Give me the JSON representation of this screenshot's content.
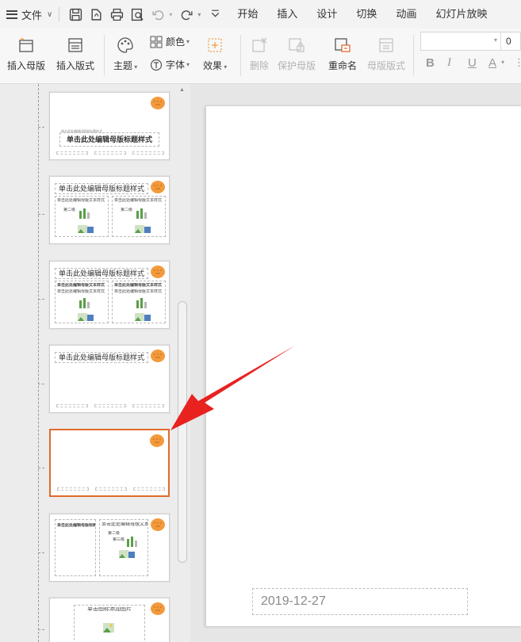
{
  "menubar": {
    "file_label": "文件",
    "tabs": [
      "开始",
      "插入",
      "设计",
      "切换",
      "动画",
      "幻灯片放映"
    ]
  },
  "ribbon": {
    "insert_master": "插入母版",
    "insert_layout": "插入版式",
    "theme": "主题",
    "color": "颜色",
    "font": "字体",
    "effect": "效果",
    "delete": "删除",
    "protect_master": "保护母版",
    "rename": "重命名",
    "master_layout": "母版版式",
    "font_size": "0",
    "bold": "B",
    "italic": "I",
    "underline": "U",
    "font_color": "A"
  },
  "thumbnails": {
    "master_title": "单击此处编辑母版标题样式",
    "master_subtitle": "单击此处编辑母版副标题样式",
    "layout_title": "单击此处编辑母版标题样式",
    "layout_text": "单击此处编辑母版文本样式",
    "layout_picture": "单击图标添加图片",
    "bullet_1": "单击此处编辑母版文本样式",
    "bullet_2": "第二级",
    "bullet_3": "第三级"
  },
  "slide": {
    "date_text": "2019-12-27"
  },
  "colors": {
    "accent": "#e06b2c",
    "arrow": "#e8221f",
    "mascot": "#f39a3d"
  }
}
